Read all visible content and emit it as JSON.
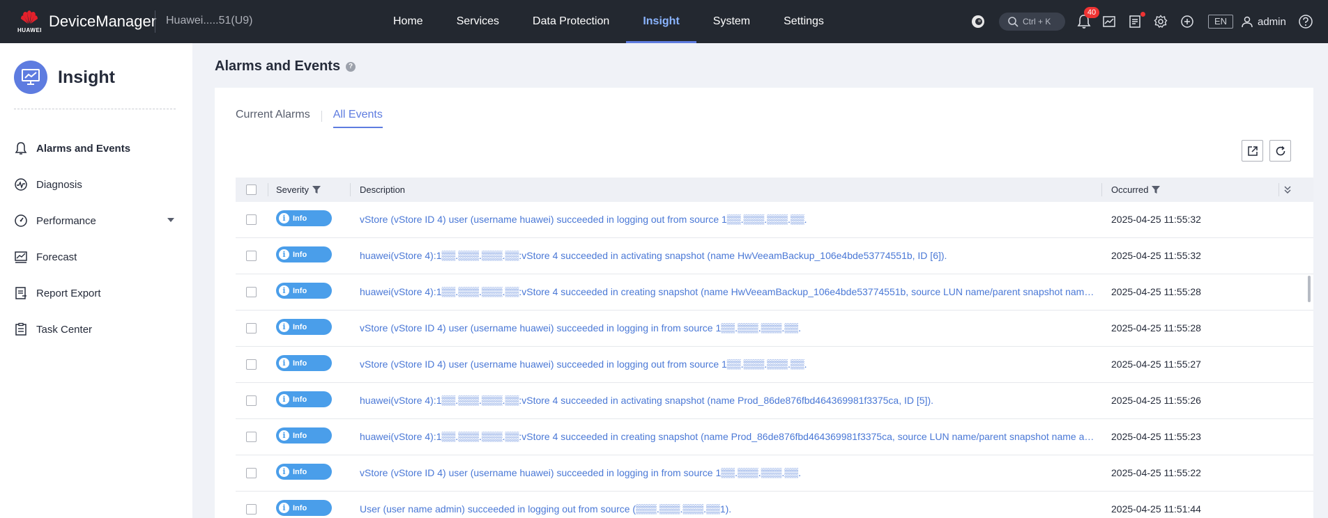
{
  "topbar": {
    "brand": "HUAWEI",
    "app_name": "DeviceManager",
    "device_name": "Huawei.....51(U9)",
    "nav": [
      {
        "label": "Home",
        "active": false
      },
      {
        "label": "Services",
        "active": false
      },
      {
        "label": "Data Protection",
        "active": false
      },
      {
        "label": "Insight",
        "active": true
      },
      {
        "label": "System",
        "active": false
      },
      {
        "label": "Settings",
        "active": false
      }
    ],
    "search_shortcut": "Ctrl + K",
    "notification_count": "40",
    "language": "EN",
    "username": "admin",
    "icons": [
      "assistant-icon",
      "search-icon",
      "bell-icon",
      "monitor-chart-icon",
      "task-list-icon",
      "gear-icon",
      "plus-circle-icon",
      "user-icon",
      "help-icon"
    ]
  },
  "sidebar": {
    "title": "Insight",
    "items": [
      {
        "label": "Alarms and Events",
        "icon": "bell-icon",
        "active": true
      },
      {
        "label": "Diagnosis",
        "icon": "diagnosis-icon",
        "active": false
      },
      {
        "label": "Performance",
        "icon": "gauge-icon",
        "active": false,
        "expandable": true
      },
      {
        "label": "Forecast",
        "icon": "forecast-chart-icon",
        "active": false
      },
      {
        "label": "Report Export",
        "icon": "report-icon",
        "active": false
      },
      {
        "label": "Task Center",
        "icon": "clipboard-icon",
        "active": false
      }
    ]
  },
  "main": {
    "title": "Alarms and Events",
    "tabs": [
      {
        "label": "Current Alarms",
        "active": false
      },
      {
        "label": "All Events",
        "active": true
      }
    ],
    "table": {
      "columns": {
        "severity": "Severity",
        "description": "Description",
        "occurred": "Occurred"
      },
      "rows": [
        {
          "severity": "Info",
          "description": "vStore (vStore ID 4) user (username huawei) succeeded in logging out from source 1▒▒.▒▒▒.▒▒▒.▒▒.",
          "occurred": "2025-04-25 11:55:32"
        },
        {
          "severity": "Info",
          "description": "huawei(vStore 4):1▒▒.▒▒▒.▒▒▒.▒▒:vStore 4 succeeded in activating snapshot (name HwVeeamBackup_106e4bde53774551b, ID [6]).",
          "occurred": "2025-04-25 11:55:32"
        },
        {
          "severity": "Info",
          "description": "huawei(vStore 4):1▒▒.▒▒▒.▒▒▒.▒▒:vStore 4 succeeded in creating snapshot (name HwVeeamBackup_106e4bde53774551b, source LUN name/parent snapshot name apl...",
          "occurred": "2025-04-25 11:55:28"
        },
        {
          "severity": "Info",
          "description": "vStore (vStore ID 4) user (username huawei) succeeded in logging in from source 1▒▒.▒▒▒.▒▒▒.▒▒.",
          "occurred": "2025-04-25 11:55:28"
        },
        {
          "severity": "Info",
          "description": "vStore (vStore ID 4) user (username huawei) succeeded in logging out from source 1▒▒.▒▒▒.▒▒▒.▒▒.",
          "occurred": "2025-04-25 11:55:27"
        },
        {
          "severity": "Info",
          "description": "huawei(vStore 4):1▒▒.▒▒▒.▒▒▒.▒▒:vStore 4 succeeded in activating snapshot (name Prod_86de876fbd464369981f3375ca, ID [5]).",
          "occurred": "2025-04-25 11:55:26"
        },
        {
          "severity": "Info",
          "description": "huawei(vStore 4):1▒▒.▒▒▒.▒▒▒.▒▒:vStore 4 succeeded in creating snapshot (name Prod_86de876fbd464369981f3375ca, source LUN name/parent snapshot name apl...",
          "occurred": "2025-04-25 11:55:23"
        },
        {
          "severity": "Info",
          "description": "vStore (vStore ID 4) user (username huawei) succeeded in logging in from source 1▒▒.▒▒▒.▒▒▒.▒▒.",
          "occurred": "2025-04-25 11:55:22"
        },
        {
          "severity": "Info",
          "description": "User (user name admin) succeeded in logging out from source (▒▒▒.▒▒▒.▒▒▒.▒▒1).",
          "occurred": "2025-04-25 11:51:44"
        }
      ]
    }
  },
  "colors": {
    "topbar_bg": "#232830",
    "accent": "#5e7ce0",
    "info_badge": "#4a9eea",
    "link": "#4a78d6",
    "alert": "#e33333"
  }
}
